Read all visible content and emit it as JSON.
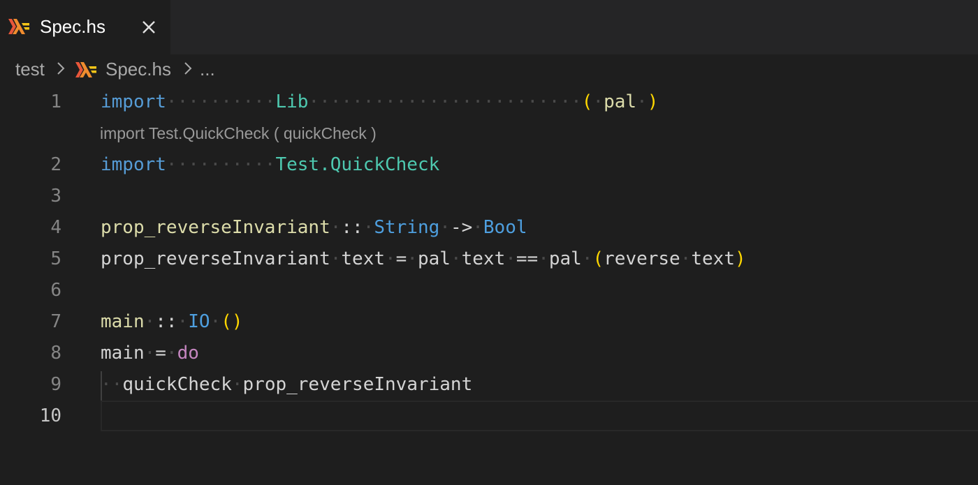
{
  "tab": {
    "icon": "haskell-logo-icon",
    "label": "Spec.hs",
    "close_icon": "close-icon"
  },
  "breadcrumb": {
    "folder": "test",
    "file": "Spec.hs",
    "more": "..."
  },
  "codelens": "import Test.QuickCheck ( quickCheck )",
  "line_numbers": [
    "1",
    "2",
    "3",
    "4",
    "5",
    "6",
    "7",
    "8",
    "9",
    "10"
  ],
  "active_line": "10",
  "code": {
    "l1": {
      "kw": "import",
      "module": "Lib",
      "open": "(",
      "name": "pal",
      "close": ")"
    },
    "l2": {
      "kw": "import",
      "module": "Test.QuickCheck"
    },
    "l4": {
      "fn": "prop_reverseInvariant",
      "sig": "::",
      "t1": "String",
      "arrow": "->",
      "t2": "Bool"
    },
    "l5": {
      "fn": "prop_reverseInvariant",
      "a1": "text",
      "eq": "=",
      "p1": "pal",
      "a2": "text",
      "eqeq": "==",
      "p2": "pal",
      "open": "(",
      "rev": "reverse",
      "a3": "text",
      "close": ")"
    },
    "l7": {
      "fn": "main",
      "sig": "::",
      "t1": "IO",
      "unit": "()"
    },
    "l8": {
      "name": "main",
      "eq": "=",
      "do": "do"
    },
    "l9": {
      "call": "quickCheck",
      "arg": "prop_reverseInvariant"
    }
  },
  "colors": {
    "background": "#1e1e1e",
    "keyword": "#569cd6",
    "module": "#4ec9b0",
    "function": "#dcdcaa",
    "type": "#4e9fdf",
    "bracket": "#ffd700",
    "do": "#c586c0"
  }
}
